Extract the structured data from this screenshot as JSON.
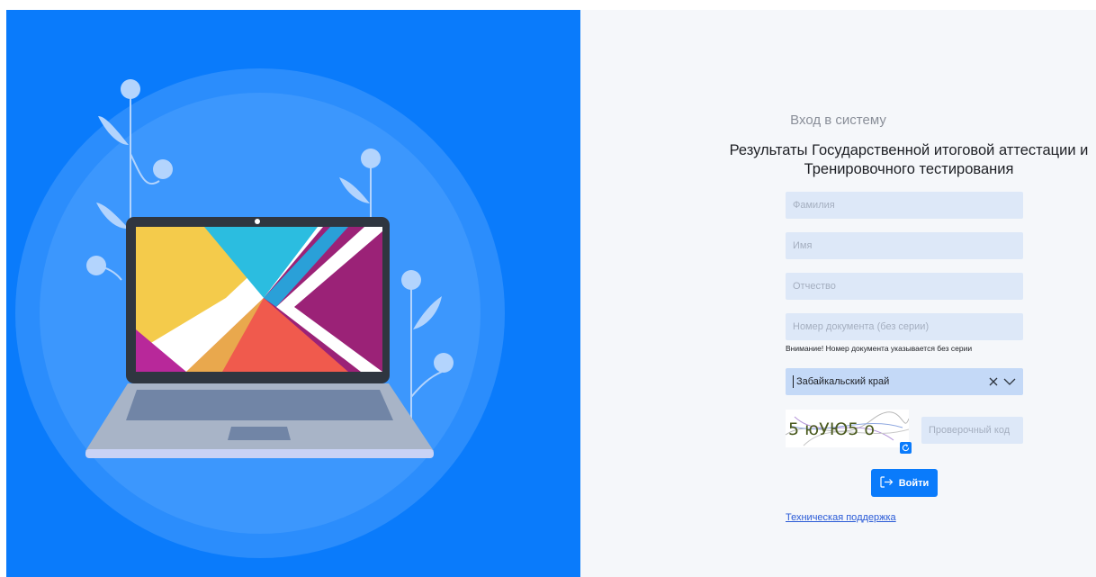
{
  "login": {
    "heading": "Вход в систему",
    "subtitle": "Результаты Государственной итоговой аттестации и Тренировочного тестирования",
    "fields": {
      "surname": {
        "placeholder": "Фамилия",
        "value": ""
      },
      "name": {
        "placeholder": "Имя",
        "value": ""
      },
      "patronymic": {
        "placeholder": "Отчество",
        "value": ""
      },
      "document": {
        "placeholder": "Номер документа (без серии)",
        "value": ""
      }
    },
    "document_note": "Внимание! Номер документа указывается без серии",
    "region": {
      "selected": "Забайкальский край"
    },
    "captcha": {
      "code_text": "5 юУЮ5 о",
      "input_placeholder": "Проверочный код",
      "refresh_icon": "refresh-icon"
    },
    "submit": {
      "label": "Войти",
      "icon": "login-arrow-icon"
    },
    "support_link": "Техническая поддержка"
  },
  "colors": {
    "brand_blue": "#0a7bfb",
    "field_bg": "#dde8f8",
    "select_bg": "#c4d9f7",
    "panel_bg": "#f5f7fa",
    "link": "#2a5bd7"
  },
  "illustration": {
    "subject": "laptop-illustration"
  }
}
